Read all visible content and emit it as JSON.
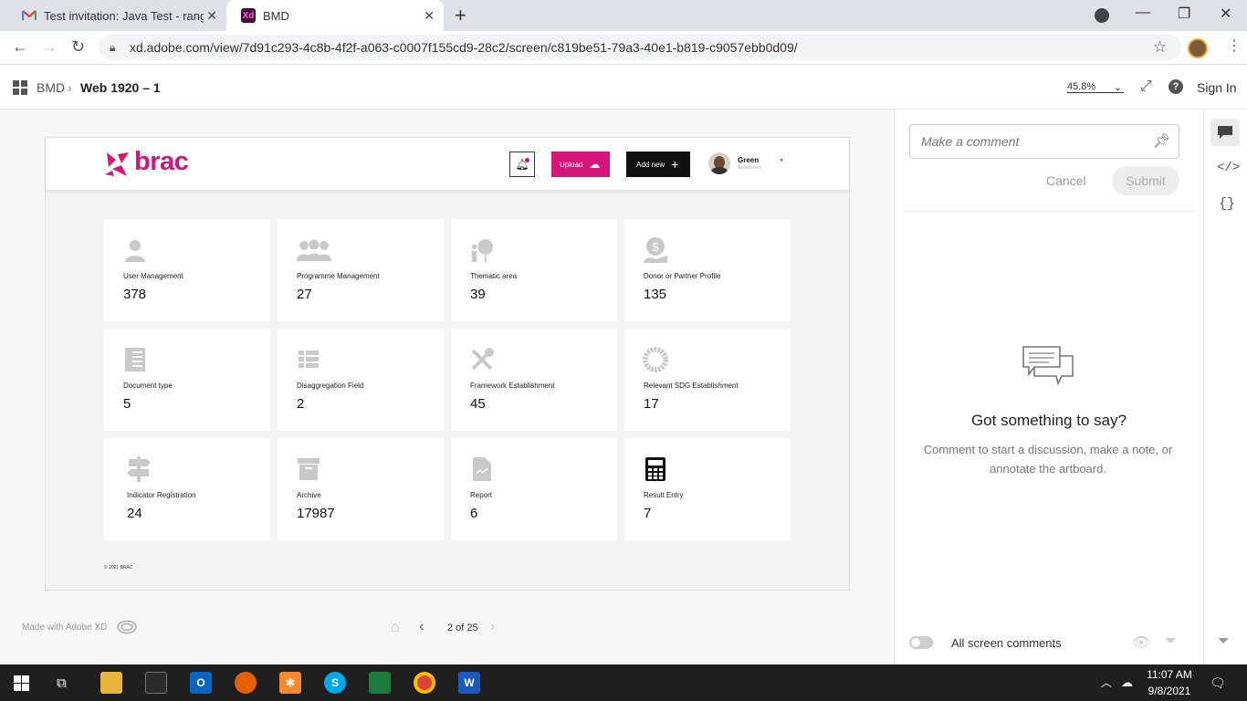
{
  "browser": {
    "tabs": [
      {
        "title": "Test invitation: Java Test - rangera",
        "favicon": "gmail-icon",
        "active": false
      },
      {
        "title": "BMD",
        "favicon": "xd-icon",
        "active": true
      }
    ],
    "url": "xd.adobe.com/view/7d91c293-4c8b-4f2f-a063-c0007f155cd9-28c2/screen/c819be51-79a3-40e1-b819-c9057ebb0d09/"
  },
  "xd_header": {
    "breadcrumb_root": "BMD",
    "breadcrumb_current": "Web 1920 – 1",
    "zoom": "45.8%",
    "sign_in": "Sign In"
  },
  "app": {
    "logo_text": "brac",
    "upload_label": "Upload",
    "add_new_label": "Add new",
    "user_name": "Green",
    "user_role": "Researcher",
    "footer": "© 2021 BRAC",
    "brand_color": "#d6157a",
    "cards": [
      {
        "label": "User Management",
        "value": "378",
        "icon": "user-icon"
      },
      {
        "label": "Programme Management",
        "value": "27",
        "icon": "group-icon"
      },
      {
        "label": "Thematic area",
        "value": "39",
        "icon": "thematic-icon"
      },
      {
        "label": "Donor or Partner Profile",
        "value": "135",
        "icon": "donor-icon"
      },
      {
        "label": "Document type",
        "value": "5",
        "icon": "document-icon"
      },
      {
        "label": "Disaggregation Field",
        "value": "2",
        "icon": "list-icon"
      },
      {
        "label": "Framework Establishment",
        "value": "45",
        "icon": "tools-icon"
      },
      {
        "label": "Relevant SDG Establishment",
        "value": "17",
        "icon": "sdg-icon"
      },
      {
        "label": "Indicator Registration",
        "value": "24",
        "icon": "signpost-icon"
      },
      {
        "label": "Archive",
        "value": "17987",
        "icon": "archive-icon"
      },
      {
        "label": "Report",
        "value": "6",
        "icon": "report-icon"
      },
      {
        "label": "Result Entry",
        "value": "7",
        "icon": "calculator-icon"
      }
    ]
  },
  "viewer_footer": {
    "made_with": "Made with Adobe XD",
    "pager": "2 of 25"
  },
  "comments": {
    "placeholder": "Make a comment",
    "cancel": "Cancel",
    "submit": "Submit",
    "empty_title": "Got something to say?",
    "empty_body": "Comment to start a discussion, make a note, or annotate the artboard.",
    "toggle_label": "All screen comments"
  },
  "taskbar": {
    "time": "11:07 AM",
    "date": "9/8/2021"
  }
}
